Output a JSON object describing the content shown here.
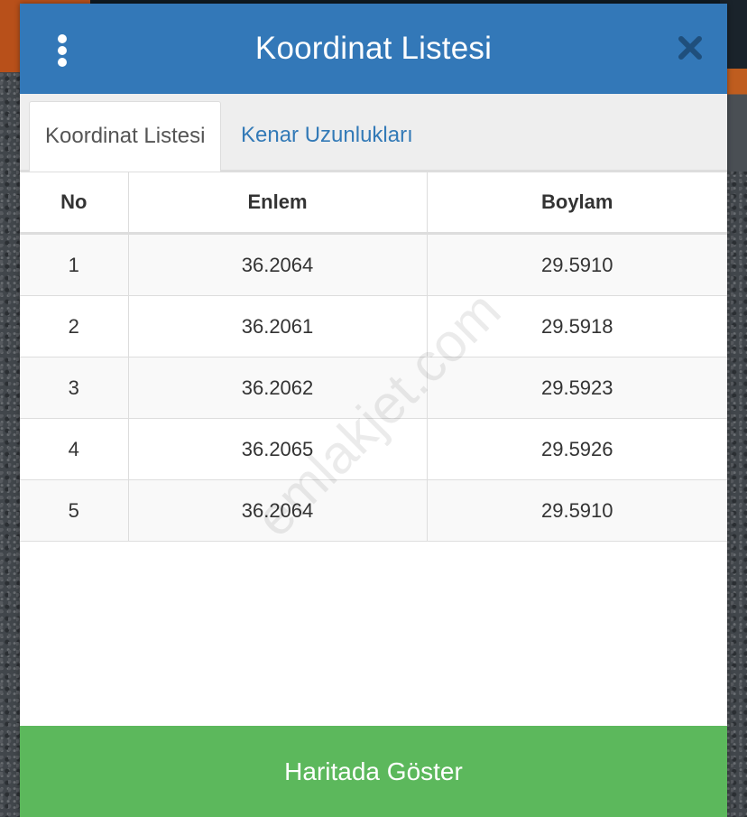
{
  "header": {
    "title": "Koordinat Listesi",
    "menu_icon": "vertical-dots-icon",
    "close_icon": "close-icon"
  },
  "tabs": [
    {
      "label": "Koordinat Listesi",
      "active": true
    },
    {
      "label": "Kenar Uzunlukları",
      "active": false
    }
  ],
  "table": {
    "columns": [
      "No",
      "Enlem",
      "Boylam"
    ],
    "rows": [
      [
        "1",
        "36.2064",
        "29.5910"
      ],
      [
        "2",
        "36.2061",
        "29.5918"
      ],
      [
        "3",
        "36.2062",
        "29.5923"
      ],
      [
        "4",
        "36.2065",
        "29.5926"
      ],
      [
        "5",
        "36.2064",
        "29.5910"
      ]
    ]
  },
  "footer": {
    "button_label": "Haritada Göster"
  },
  "watermark": "emlakjet.com",
  "colors": {
    "header": "#3378b8",
    "footer_button": "#5cb85c",
    "tab_link": "#337ab7"
  }
}
